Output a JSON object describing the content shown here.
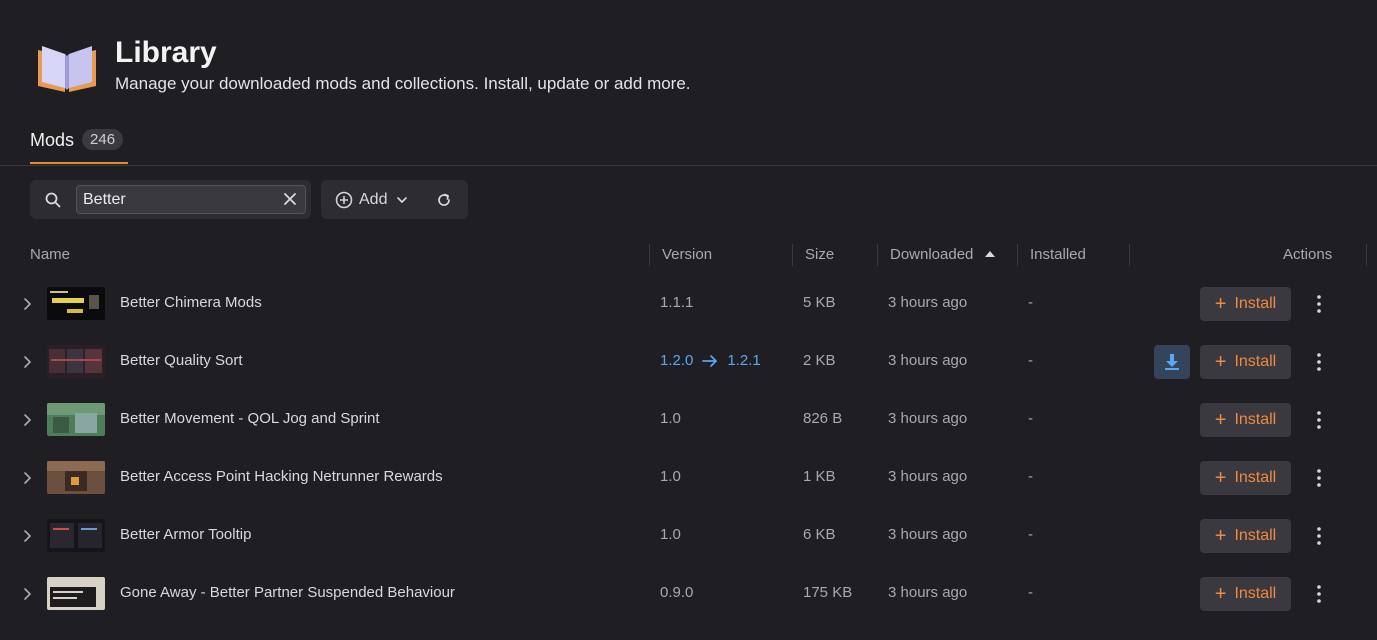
{
  "header": {
    "title": "Library",
    "subtitle": "Manage your downloaded mods and collections. Install, update or add more.",
    "logo_icon": "open-book-icon"
  },
  "tabs": [
    {
      "label": "Mods",
      "count": "246",
      "active": true
    }
  ],
  "toolbar": {
    "search_value": "Better",
    "add_label": "Add"
  },
  "columns": {
    "name": "Name",
    "version": "Version",
    "size": "Size",
    "downloaded": "Downloaded",
    "installed": "Installed",
    "actions": "Actions"
  },
  "rows": [
    {
      "name": "Better Chimera Mods",
      "version": "1.1.1",
      "size": "5 KB",
      "downloaded": "3 hours ago",
      "installed": "-",
      "install_label": "Install"
    },
    {
      "name": "Better Quality Sort",
      "version_from": "1.2.0",
      "version_to": "1.2.1",
      "size": "2 KB",
      "downloaded": "3 hours ago",
      "installed": "-",
      "install_label": "Install"
    },
    {
      "name": "Better Movement - QOL Jog and Sprint",
      "version": "1.0",
      "size": "826 B",
      "downloaded": "3 hours ago",
      "installed": "-",
      "install_label": "Install"
    },
    {
      "name": "Better Access Point Hacking Netrunner Rewards",
      "version": "1.0",
      "size": "1 KB",
      "downloaded": "3 hours ago",
      "installed": "-",
      "install_label": "Install"
    },
    {
      "name": "Better Armor Tooltip",
      "version": "1.0",
      "size": "6 KB",
      "downloaded": "3 hours ago",
      "installed": "-",
      "install_label": "Install"
    },
    {
      "name": "Gone Away - Better Partner Suspended Behaviour",
      "version": "0.9.0",
      "size": "175 KB",
      "downloaded": "3 hours ago",
      "installed": "-",
      "install_label": "Install"
    }
  ],
  "colors": {
    "background": "#1f1e23",
    "accent": "#e8883a",
    "update": "#5aa7f0"
  }
}
